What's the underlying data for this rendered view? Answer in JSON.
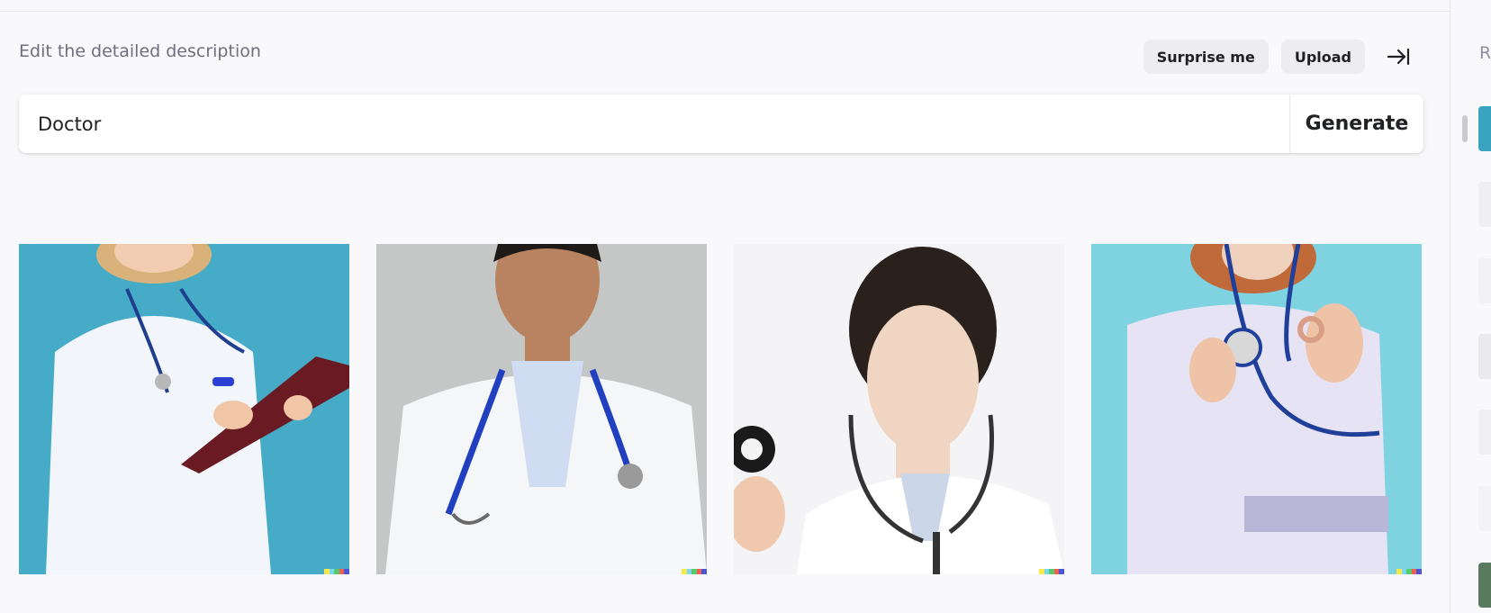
{
  "prompt": {
    "header": "Edit the detailed description",
    "value": "Doctor",
    "generate_label": "Generate"
  },
  "actions": {
    "surprise_label": "Surprise me",
    "upload_label": "Upload",
    "collapse_icon": "arrow-right-to-line-icon"
  },
  "results": [
    {
      "subject": "smiling nurse with clipboard",
      "bg": "#3aa3c0"
    },
    {
      "subject": "male doctor with stethoscope",
      "bg": "#c4c7c6"
    },
    {
      "subject": "female doctor holding stethoscope",
      "bg": "#f4f4f6"
    },
    {
      "subject": "doctor making ok gesture",
      "bg": "#7fd3e0"
    }
  ],
  "sidebar": {
    "title": "R"
  },
  "colors": {
    "accent_text": "#202123",
    "muted_text": "#6e6e80",
    "pill_bg": "#ececf1",
    "page_bg": "#f9f9fb"
  }
}
